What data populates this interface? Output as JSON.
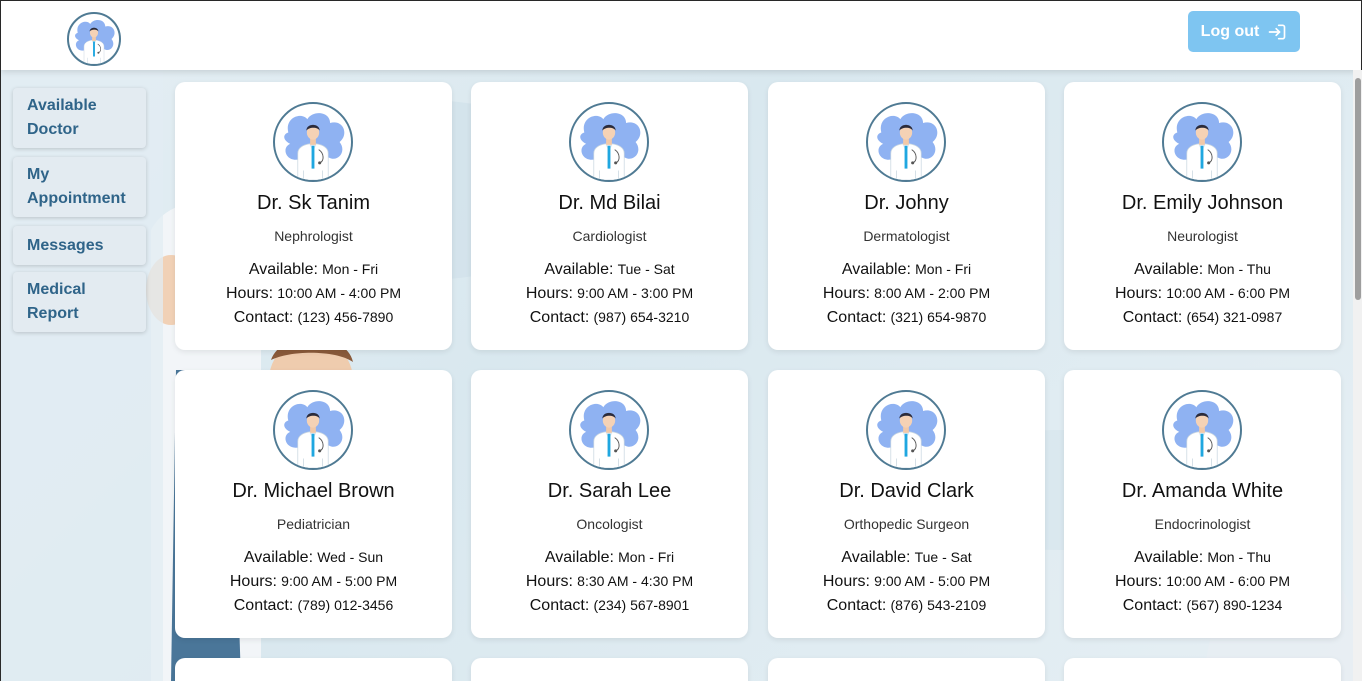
{
  "header": {
    "logo_icon": "doctor-avatar-icon",
    "logout_label": "Log out",
    "logout_icon": "logout-arrow-icon"
  },
  "sidebar": {
    "items": [
      {
        "line1": "Available",
        "line2": "Doctor"
      },
      {
        "line1": "My",
        "line2": "Appointment"
      },
      {
        "line1": "Messages",
        "line2": ""
      },
      {
        "line1": "Medical",
        "line2": "Report"
      }
    ]
  },
  "labels": {
    "available": "Available:",
    "hours": "Hours:",
    "contact": "Contact:"
  },
  "doctors": [
    {
      "name": "Dr. Sk Tanim",
      "specialty": "Nephrologist",
      "available": "Mon - Fri",
      "hours": "10:00 AM - 4:00 PM",
      "contact": "(123) 456-7890"
    },
    {
      "name": "Dr. Md Bilai",
      "specialty": "Cardiologist",
      "available": "Tue - Sat",
      "hours": "9:00 AM - 3:00 PM",
      "contact": "(987) 654-3210"
    },
    {
      "name": "Dr. Johny",
      "specialty": "Dermatologist",
      "available": "Mon - Fri",
      "hours": "8:00 AM - 2:00 PM",
      "contact": "(321) 654-9870"
    },
    {
      "name": "Dr. Emily Johnson",
      "specialty": "Neurologist",
      "available": "Mon - Thu",
      "hours": "10:00 AM - 6:00 PM",
      "contact": "(654) 321-0987"
    },
    {
      "name": "Dr. Michael Brown",
      "specialty": "Pediatrician",
      "available": "Wed - Sun",
      "hours": "9:00 AM - 5:00 PM",
      "contact": "(789) 012-3456"
    },
    {
      "name": "Dr. Sarah Lee",
      "specialty": "Oncologist",
      "available": "Mon - Fri",
      "hours": "8:30 AM - 4:30 PM",
      "contact": "(234) 567-8901"
    },
    {
      "name": "Dr. David Clark",
      "specialty": "Orthopedic Surgeon",
      "available": "Tue - Sat",
      "hours": "9:00 AM - 5:00 PM",
      "contact": "(876) 543-2109"
    },
    {
      "name": "Dr. Amanda White",
      "specialty": "Endocrinologist",
      "available": "Mon - Thu",
      "hours": "10:00 AM - 6:00 PM",
      "contact": "(567) 890-1234"
    }
  ],
  "colors": {
    "accent": "#7ec5f1",
    "nav_text": "#2f6489",
    "avatar_blob": "#8fb2f2",
    "tie": "#1fa7e0"
  }
}
